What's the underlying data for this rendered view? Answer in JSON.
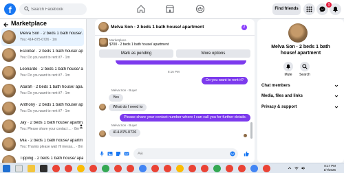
{
  "topbar": {
    "search_placeholder": "Search Facebook",
    "find_friends": "Find friends",
    "notification_count": "1"
  },
  "sidebar": {
    "title": "Marketplace",
    "conversations": [
      {
        "name": "Melva Son · 2 beds 1 bath house/...",
        "preview": "You: 414-875-0726 · 1m",
        "active": true
      },
      {
        "name": "Escobar · 2 beds 1 bath house/ apa...",
        "preview": "You: Do you want to rent it? · 1m"
      },
      {
        "name": "Leonardo · 2 beds 1 bath house/ apa...",
        "preview": "You: Do you want to rent it? · 1m"
      },
      {
        "name": "Atarah · 2 beds 1 bath house/ apa...",
        "preview": "You: Do you want to rent it? · 1m"
      },
      {
        "name": "Anthony · 2 beds 1 bath house/ apa...",
        "preview": "You: Do you want to rent it? · 1m"
      },
      {
        "name": "Jay · 2 beds 1 bath house/ apartm...",
        "preview": "You: Please share your contact ... · 8m"
      },
      {
        "name": "Mia · 2 beds 1 bath house/ apartm...",
        "preview": "You: Thanks please wait I'll messa... · 8m"
      },
      {
        "name": "Tipping · 2 beds 1 bath house/ apart...",
        "preview": ""
      }
    ]
  },
  "chat": {
    "title": "Melva Son · 2 beds 1 bath house/ apartment",
    "listing_kicker": "Marketplace",
    "listing_sub": "$700 · 2 beds 1 bath house/ apartment",
    "mark_pending": "Mark as pending",
    "more_options": "More options",
    "timestamp": "8:16 PM",
    "sender_label_1": "Melva Son · Buyer",
    "sender_label_2": "Melva Son · Buyer",
    "messages": {
      "out1": "Do you want to rent it?",
      "in1": "Yes",
      "in2": "What do I need to",
      "out2": "Please share your contact number where I can call you for further details.",
      "in3": "414-875-0726"
    },
    "composer_placeholder": "Aa"
  },
  "rpanel": {
    "name": "Melva Son · 2 beds 1 bath house/ apartment",
    "mute": "Mute",
    "search": "Search",
    "sections": [
      "Chat members",
      "Media, files and links",
      "Privacy & support"
    ]
  },
  "taskbar": {
    "time": "8:17 PM",
    "date": "1/7/2026"
  },
  "colors": {
    "accent": "#7c3aed",
    "brand": "#1877f2"
  }
}
